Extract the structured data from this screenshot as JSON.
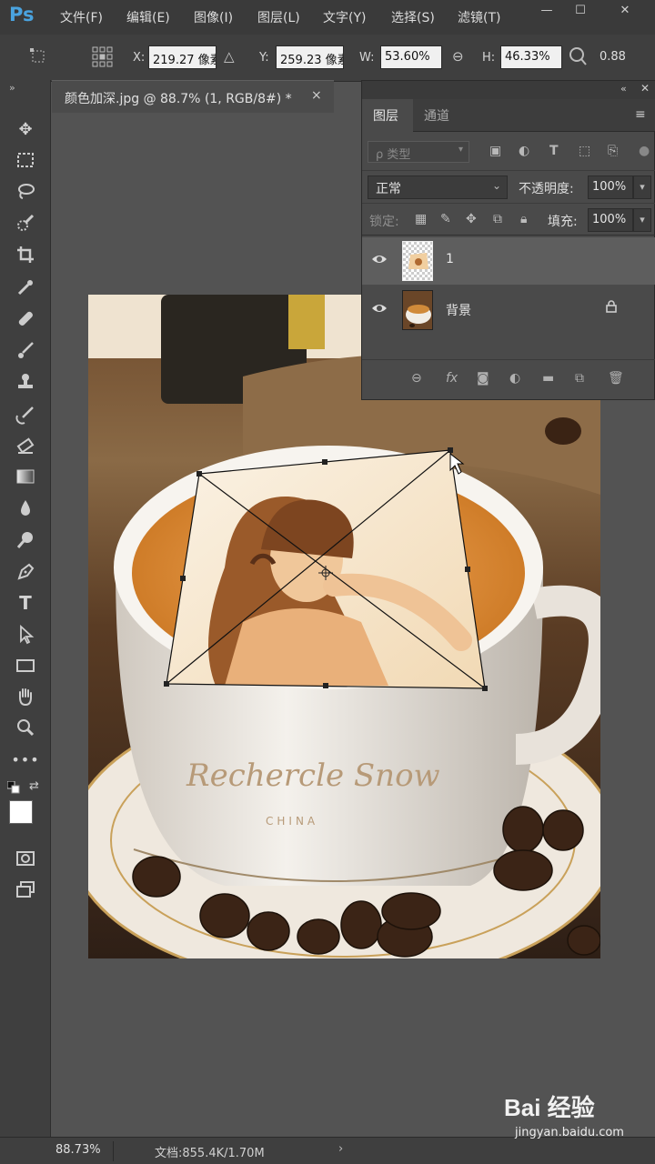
{
  "app": {
    "logo": "Ps",
    "menu": [
      "文件(F)",
      "编辑(E)",
      "图像(I)",
      "图层(L)",
      "文字(Y)",
      "选择(S)",
      "滤镜(T)"
    ],
    "window_controls": [
      "—",
      "☐",
      "✕"
    ]
  },
  "options_bar": {
    "x_label": "X:",
    "x_value": "219.27 像素",
    "y_label": "Y:",
    "y_value": "259.23 像素",
    "w_label": "W:",
    "w_value": "53.60%",
    "h_label": "H:",
    "h_value": "46.33%",
    "rotate_value": "0.88"
  },
  "document": {
    "tab_title": "颜色加深.jpg @ 88.7% (1, RGB/8#) *",
    "close": "×"
  },
  "layers_panel": {
    "tabs": [
      {
        "label": "图层",
        "active": true
      },
      {
        "label": "通道",
        "active": false
      }
    ],
    "filter_placeholder": "ρ 类型",
    "blend_mode": "正常",
    "opacity_label": "不透明度:",
    "opacity_value": "100%",
    "lock_label": "锁定:",
    "fill_label": "填充:",
    "fill_value": "100%",
    "layers": [
      {
        "name": "1",
        "selected": true,
        "visible": true,
        "locked": false
      },
      {
        "name": "背景",
        "selected": false,
        "visible": true,
        "locked": true
      }
    ]
  },
  "status": {
    "zoom": "88.73%",
    "doc_info": "文档:855.4K/1.70M",
    "arrow": "›"
  },
  "image_text": {
    "cup_script": "Rechercle Snow",
    "cup_sub": "CHINA"
  },
  "watermark": {
    "brand": "Bai 经验",
    "url": "jingyan.baidu.com"
  },
  "colors": {
    "accent": "#4aa3df",
    "chrome_dark": "#3a3a3a",
    "panel": "#4a4a4a",
    "canvas_bg": "#535353"
  }
}
